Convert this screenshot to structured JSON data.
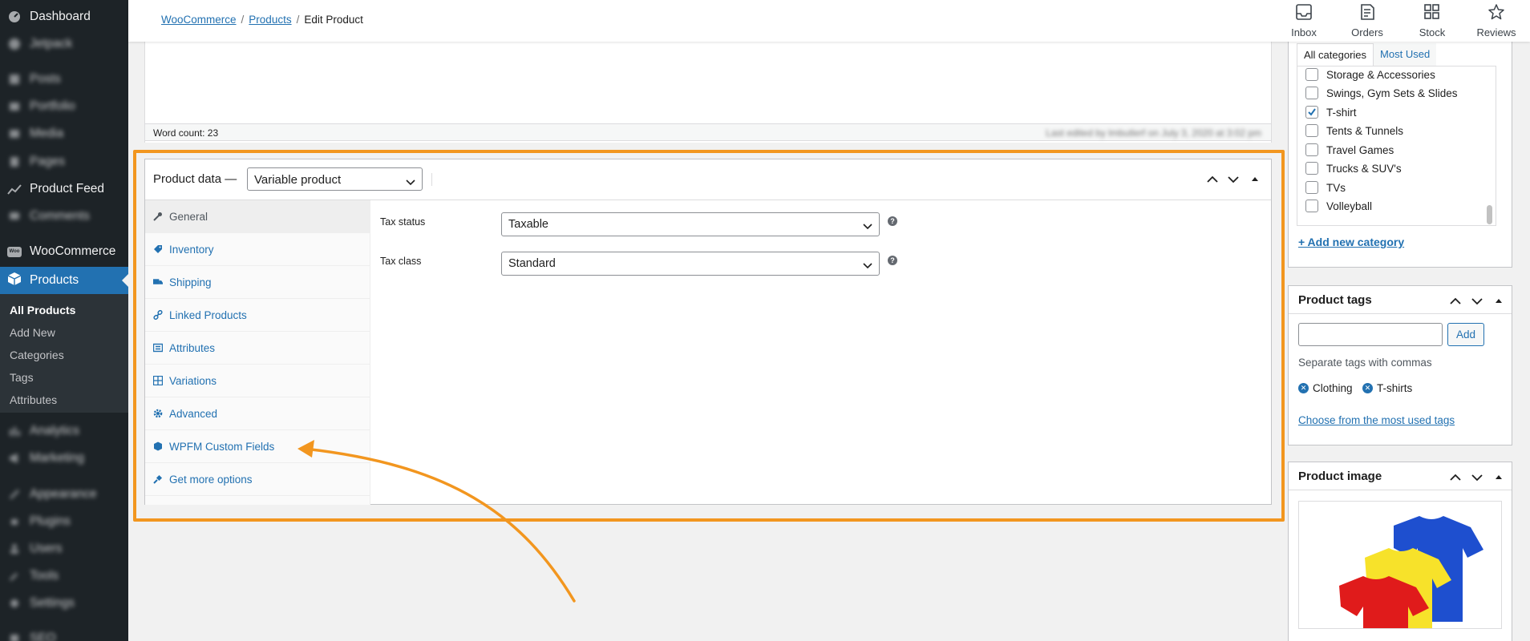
{
  "sidebar": {
    "items": [
      {
        "label": "Dashboard",
        "icon": "dashboard-icon",
        "blurred": false
      },
      {
        "label": "Jetpack",
        "icon": "jetpack-icon",
        "blurred": true
      },
      {
        "label": "Posts",
        "icon": "posts-icon",
        "blurred": true
      },
      {
        "label": "Portfolio",
        "icon": "portfolio-icon",
        "blurred": true
      },
      {
        "label": "Media",
        "icon": "media-icon",
        "blurred": true
      },
      {
        "label": "Pages",
        "icon": "pages-icon",
        "blurred": true
      },
      {
        "label": "Product Feed",
        "icon": "product-feed-icon",
        "blurred": false
      },
      {
        "label": "Comments",
        "icon": "comments-icon",
        "blurred": true
      },
      {
        "label": "WooCommerce",
        "icon": "woocommerce-icon",
        "blurred": false
      },
      {
        "label": "Products",
        "icon": "products-icon",
        "blurred": false
      },
      {
        "label": "Analytics",
        "icon": "analytics-icon",
        "blurred": true
      },
      {
        "label": "Marketing",
        "icon": "marketing-icon",
        "blurred": true
      },
      {
        "label": "Appearance",
        "icon": "appearance-icon",
        "blurred": true
      },
      {
        "label": "Plugins",
        "icon": "plugins-icon",
        "blurred": true
      },
      {
        "label": "Users",
        "icon": "users-icon",
        "blurred": true
      },
      {
        "label": "Tools",
        "icon": "tools-icon",
        "blurred": true
      },
      {
        "label": "Settings",
        "icon": "settings-icon",
        "blurred": true
      },
      {
        "label": "SEO",
        "icon": "seo-icon",
        "blurred": true
      }
    ],
    "woo_badge": "Woo",
    "submenu": [
      "All Products",
      "Add New",
      "Categories",
      "Tags",
      "Attributes"
    ]
  },
  "topbar": {
    "breadcrumb": [
      "WooCommerce",
      "Products",
      "Edit Product"
    ],
    "separator": "/",
    "actions": [
      "Inbox",
      "Orders",
      "Stock",
      "Reviews"
    ]
  },
  "editor": {
    "word_count": "Word count: 23",
    "last_edited": "Last edited by lmbutlerf on July 3, 2020 at 3:02 pm"
  },
  "product_data": {
    "title": "Product data —",
    "type_value": "Variable product",
    "tabs": [
      "General",
      "Inventory",
      "Shipping",
      "Linked Products",
      "Attributes",
      "Variations",
      "Advanced",
      "WPFM Custom Fields",
      "Get more options"
    ],
    "active_tab": "General",
    "fields": [
      {
        "label": "Tax status",
        "value": "Taxable"
      },
      {
        "label": "Tax class",
        "value": "Standard"
      }
    ],
    "help": "?"
  },
  "categories": {
    "tabs": [
      "All categories",
      "Most Used"
    ],
    "items": [
      {
        "label": "Storage & Accessories",
        "checked": false
      },
      {
        "label": "Swings, Gym Sets & Slides",
        "checked": false
      },
      {
        "label": "T-shirt",
        "checked": true
      },
      {
        "label": "Tents & Tunnels",
        "checked": false
      },
      {
        "label": "Travel Games",
        "checked": false
      },
      {
        "label": "Trucks & SUV's",
        "checked": false
      },
      {
        "label": "TVs",
        "checked": false
      },
      {
        "label": "Volleyball",
        "checked": false
      }
    ],
    "add_link": "+ Add new category"
  },
  "tags": {
    "title": "Product tags",
    "add_label": "Add",
    "hint": "Separate tags with commas",
    "chips": [
      "Clothing",
      "T-shirts"
    ],
    "most_used_link": "Choose from the most used tags"
  },
  "image": {
    "title": "Product image"
  },
  "colors": {
    "accent": "#2271b1",
    "sidebar_bg": "#1d2327",
    "highlight": "#f2961f",
    "shirt_blue": "#1e4fcf",
    "shirt_yellow": "#f7e22a",
    "shirt_red": "#e01b1b"
  }
}
